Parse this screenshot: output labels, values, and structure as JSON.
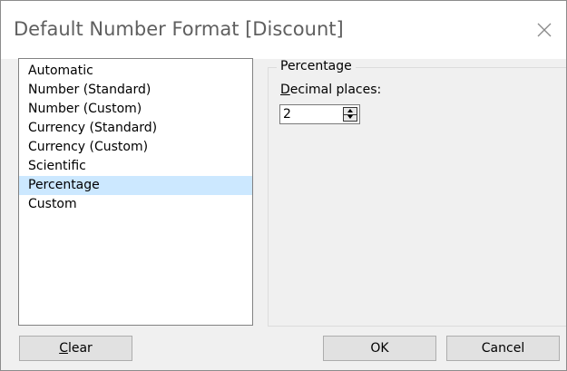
{
  "dialog": {
    "title": "Default Number Format [Discount]"
  },
  "format_list": {
    "items": [
      "Automatic",
      "Number (Standard)",
      "Number (Custom)",
      "Currency (Standard)",
      "Currency (Custom)",
      "Scientific",
      "Percentage",
      "Custom"
    ],
    "selected": "Percentage"
  },
  "options": {
    "group_title": "Percentage",
    "decimal_label_mnemonic": "D",
    "decimal_label_rest": "ecimal places:",
    "decimal_value": "2"
  },
  "buttons": {
    "clear_mnemonic": "C",
    "clear_rest": "lear",
    "ok": "OK",
    "cancel": "Cancel"
  },
  "icons": {
    "close": "close-icon",
    "spin_up": "chevron-up-icon",
    "spin_down": "chevron-down-icon"
  },
  "colors": {
    "selection": "#cce8ff",
    "dialog_bg": "#f0f0f0",
    "title_text": "#5f5f5f"
  }
}
